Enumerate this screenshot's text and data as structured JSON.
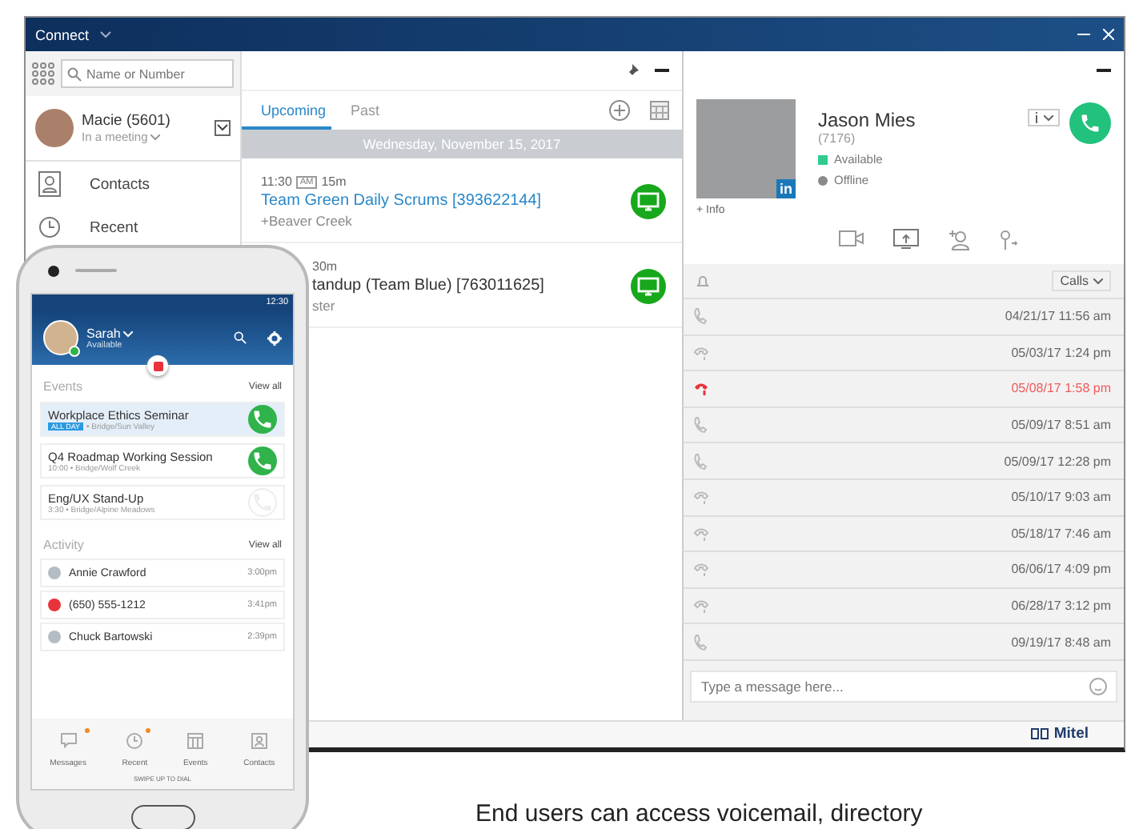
{
  "window": {
    "title": "Connect"
  },
  "sidebar": {
    "search": {
      "placeholder": "Name or Number"
    },
    "user": {
      "name": "Macie (5601)",
      "status": "In a meeting"
    },
    "items": [
      {
        "label": "Contacts",
        "selected": false
      },
      {
        "label": "Recent",
        "selected": false
      }
    ]
  },
  "events": {
    "tabs": [
      {
        "label": "Upcoming",
        "selected": true
      },
      {
        "label": "Past",
        "selected": false
      }
    ],
    "date": "Wednesday, November 15, 2017",
    "items": [
      {
        "time": "11:30",
        "meridiem": "AM",
        "duration": "15m",
        "title": "Team Green Daily Scrums [393622144]",
        "location": "+Beaver Creek"
      },
      {
        "duration": "30m",
        "title": "tandup (Team Blue) [763011625]",
        "location": "ster"
      }
    ]
  },
  "contact": {
    "name": "Jason Mies",
    "extension": "(7176)",
    "photo_badge": "in",
    "presence": [
      {
        "label": "Available",
        "color": "#2ecc8f"
      },
      {
        "label": "Offline",
        "color": "#8a8a8a"
      }
    ],
    "info_link": "+ Info",
    "filter": "Calls",
    "calls": [
      {
        "kind": "incoming",
        "time": "04/21/17 11:56 am"
      },
      {
        "kind": "outgoing",
        "time": "05/03/17 1:24 pm"
      },
      {
        "kind": "missed",
        "time": "05/08/17 1:58 pm"
      },
      {
        "kind": "incoming",
        "time": "05/09/17 8:51 am"
      },
      {
        "kind": "incoming",
        "time": "05/09/17 12:28 pm"
      },
      {
        "kind": "outgoing",
        "time": "05/10/17 9:03 am"
      },
      {
        "kind": "outgoing",
        "time": "05/18/17 7:46 am"
      },
      {
        "kind": "outgoing",
        "time": "06/06/17 4:09 pm"
      },
      {
        "kind": "outgoing",
        "time": "06/28/17 3:12 pm"
      },
      {
        "kind": "incoming",
        "time": "09/19/17 8:48 am"
      }
    ],
    "message": {
      "placeholder": "Type a message here..."
    }
  },
  "footer": {
    "brand": "Mitel"
  },
  "phone": {
    "clock": "12:30",
    "user": {
      "name": "Sarah",
      "status": "Available"
    },
    "events_heading": "Events",
    "events_link": "View all",
    "events": [
      {
        "title": "Workplace Ethics Seminar",
        "tag": "ALL DAY",
        "detail": "• Bridge/Sun Valley",
        "selected": true,
        "disabled": false
      },
      {
        "title": "Q4 Roadmap Working Session",
        "detail": "10:00 • Bridge/Wolf Creek",
        "selected": false,
        "disabled": false
      },
      {
        "title": "Eng/UX Stand-Up",
        "detail": "3:30 • Bridge/Alpine Meadows",
        "selected": false,
        "disabled": true
      }
    ],
    "activity_heading": "Activity",
    "activity_link": "View all",
    "activity": [
      {
        "name": "Annie Crawford",
        "time": "3:00pm",
        "missed": false
      },
      {
        "name": "(650) 555-1212",
        "time": "3:41pm",
        "missed": true
      },
      {
        "name": "Chuck Bartowski",
        "time": "2:39pm",
        "missed": false
      }
    ],
    "nav": [
      {
        "label": "Messages",
        "badge": true
      },
      {
        "label": "Recent",
        "badge": true
      },
      {
        "label": "Events",
        "badge": false
      },
      {
        "label": "Contacts",
        "badge": false
      }
    ],
    "hint": "SWIPE UP TO DIAL"
  },
  "caption": "End users can access voicemail, directory"
}
